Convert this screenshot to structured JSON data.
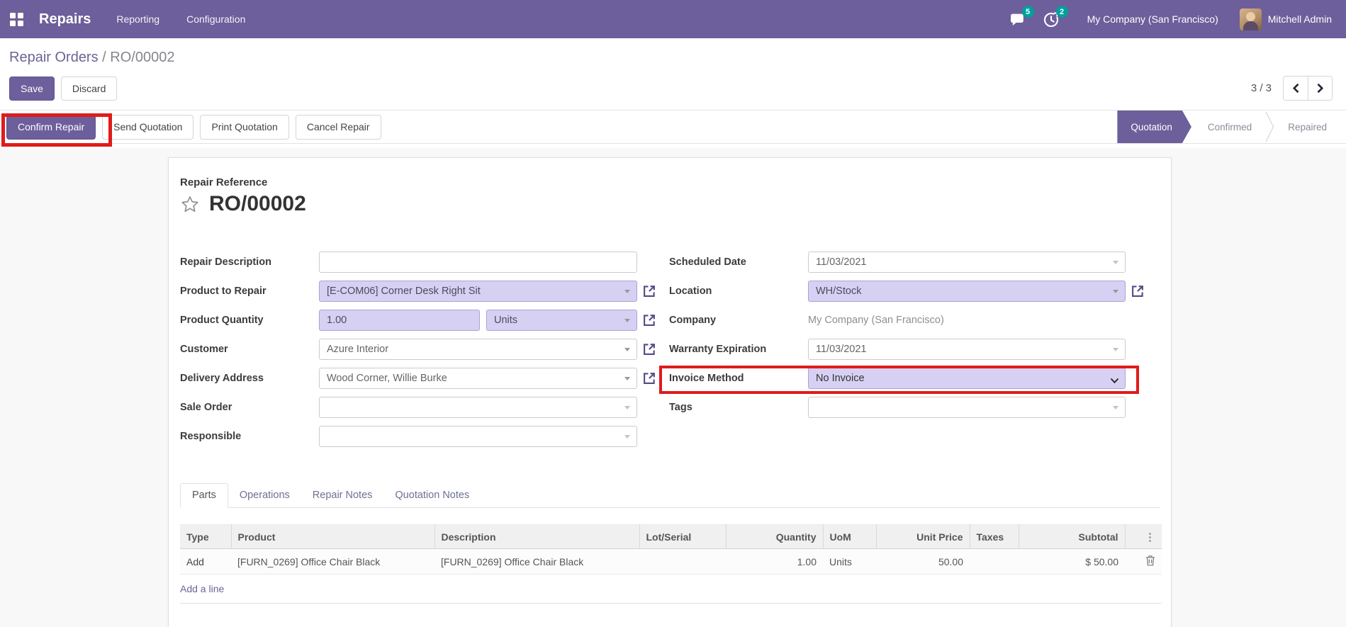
{
  "colors": {
    "brand": "#6c5f9b",
    "field_highlight": "#d6d1f3",
    "badge_teal": "#00a09d",
    "annotation_red": "#e01b1b"
  },
  "navbar": {
    "app_name": "Repairs",
    "menus": [
      "Reporting",
      "Configuration"
    ],
    "messages_badge": "5",
    "activities_badge": "2",
    "company": "My Company (San Francisco)",
    "user": "Mitchell Admin"
  },
  "breadcrumb": {
    "parent": "Repair Orders",
    "separator": "/",
    "current": "RO/00002"
  },
  "control_panel": {
    "save_label": "Save",
    "discard_label": "Discard",
    "pager": "3 / 3"
  },
  "statusbar": {
    "buttons": [
      {
        "label": "Confirm Repair"
      },
      {
        "label": "Send Quotation"
      },
      {
        "label": "Print Quotation"
      },
      {
        "label": "Cancel Repair"
      }
    ],
    "stages": [
      {
        "label": "Quotation",
        "active": true
      },
      {
        "label": "Confirmed",
        "active": false
      },
      {
        "label": "Repaired",
        "active": false
      }
    ]
  },
  "form": {
    "reference_label": "Repair Reference",
    "reference": "RO/00002",
    "left": {
      "repair_description": {
        "label": "Repair Description",
        "value": ""
      },
      "product_to_repair": {
        "label": "Product to Repair",
        "value": "[E-COM06] Corner Desk Right Sit"
      },
      "product_quantity": {
        "label": "Product Quantity",
        "quantity": "1.00",
        "uom": "Units"
      },
      "customer": {
        "label": "Customer",
        "value": "Azure Interior"
      },
      "delivery_address": {
        "label": "Delivery Address",
        "value": "Wood Corner, Willie Burke"
      },
      "sale_order": {
        "label": "Sale Order",
        "value": ""
      },
      "responsible": {
        "label": "Responsible",
        "value": ""
      }
    },
    "right": {
      "scheduled_date": {
        "label": "Scheduled Date",
        "value": "11/03/2021"
      },
      "location": {
        "label": "Location",
        "value": "WH/Stock"
      },
      "company": {
        "label": "Company",
        "value": "My Company (San Francisco)"
      },
      "warranty_expiration": {
        "label": "Warranty Expiration",
        "value": "11/03/2021"
      },
      "invoice_method": {
        "label": "Invoice Method",
        "value": "No Invoice"
      },
      "tags": {
        "label": "Tags",
        "value": ""
      }
    }
  },
  "tabs": [
    {
      "label": "Parts",
      "active": true
    },
    {
      "label": "Operations",
      "active": false
    },
    {
      "label": "Repair Notes",
      "active": false
    },
    {
      "label": "Quotation Notes",
      "active": false
    }
  ],
  "parts": {
    "columns": {
      "type": "Type",
      "product": "Product",
      "description": "Description",
      "lot": "Lot/Serial",
      "qty": "Quantity",
      "uom": "UoM",
      "price": "Unit Price",
      "taxes": "Taxes",
      "subtotal": "Subtotal"
    },
    "rows": [
      {
        "type": "Add",
        "product": "[FURN_0269] Office Chair Black",
        "description": "[FURN_0269] Office Chair Black",
        "lot": "",
        "qty": "1.00",
        "uom": "Units",
        "price": "50.00",
        "taxes": "",
        "subtotal": "$ 50.00"
      }
    ],
    "add_line_label": "Add a line"
  }
}
